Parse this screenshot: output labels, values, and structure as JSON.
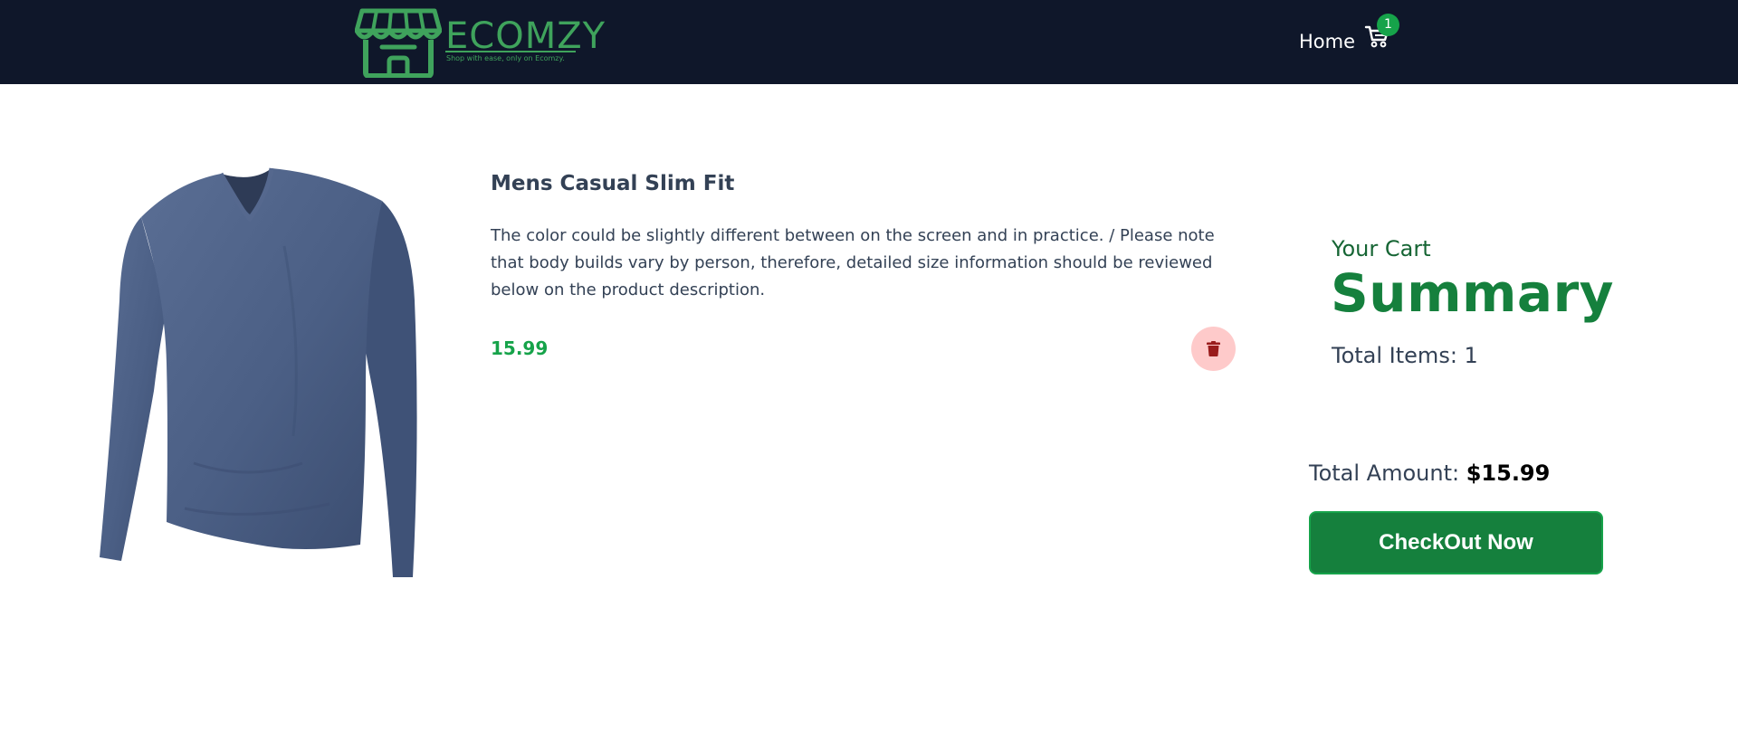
{
  "brand": {
    "name": "ECOMZY",
    "tagline": "Shop with ease, only on Ecomzy.",
    "color": "#3fa35c"
  },
  "nav": {
    "home_label": "Home",
    "cart_icon": "shopping-cart-icon",
    "cart_count": "1"
  },
  "cart_item": {
    "title": "Mens Casual Slim Fit",
    "description": "The color could be slightly different between on the screen and in practice. / Please note that body builds vary by person, therefore, detailed size information should be reviewed below on the product description.",
    "price": "15.99",
    "delete_icon": "trash-icon"
  },
  "summary": {
    "subtitle": "Your Cart",
    "heading": "Summary",
    "total_items": "Total Items: 1",
    "total_amount_label": "Total Amount: ",
    "total_amount_value": "$15.99",
    "checkout_label": "CheckOut Now"
  },
  "colors": {
    "navbar_bg": "#0f172a",
    "accent_green": "#15803d",
    "price_green": "#16a34a",
    "delete_bg": "#fecaca",
    "delete_icon": "#991b1b"
  }
}
